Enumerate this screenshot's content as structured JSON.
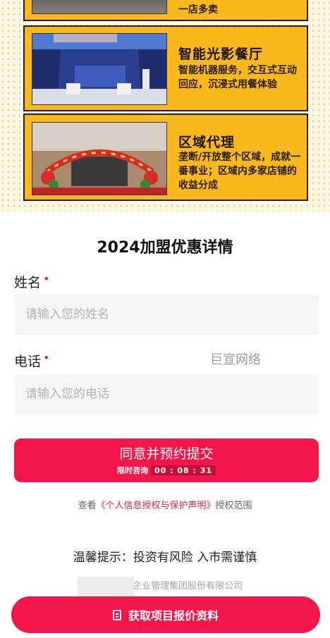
{
  "promo": {
    "cards": [
      {
        "title": "",
        "desc": "一店多卖"
      },
      {
        "title": "智能光影餐厅",
        "desc": "智能机器服务，交互式互动回应，沉浸式用餐体验"
      },
      {
        "title": "区域代理",
        "desc": "垄断/开放整个区域，成就一番事业；区域内多家店铺的收益分成"
      }
    ]
  },
  "form": {
    "title": "2024加盟优惠详情",
    "name_label": "姓名",
    "name_placeholder": "请输入您的姓名",
    "phone_label": "电话",
    "phone_placeholder": "请输入您的电话",
    "required_mark": "•",
    "watermark": "巨宣网络",
    "submit_label": "同意并预约提交",
    "countdown_label": "限时咨询",
    "countdown_value": "00 : 08 : 31"
  },
  "notice": {
    "prefix": "查看",
    "link": "《个人信息授权与保护声明》",
    "suffix": "授权范围"
  },
  "tip": "温馨提示：投资有风险 入市需谨慎",
  "company": "企业管理集团股份有限公司",
  "cta_label": "获取项目报价资料",
  "colors": {
    "accent": "#f2164a",
    "banner": "#f9b81b"
  }
}
